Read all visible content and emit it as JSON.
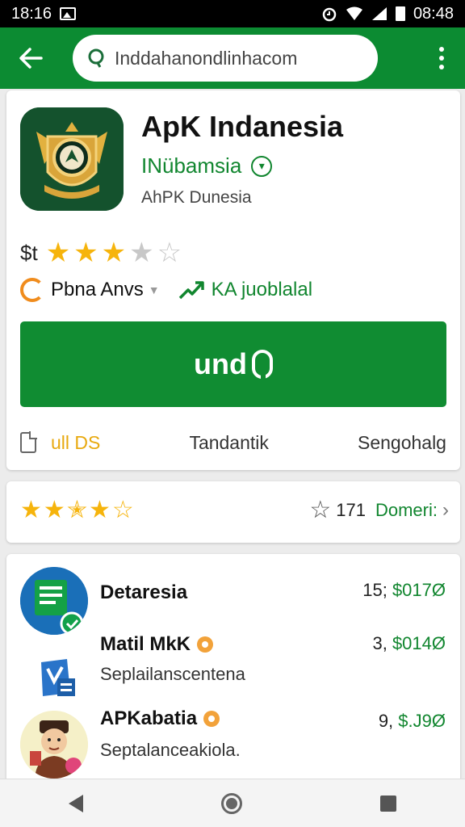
{
  "status_bar": {
    "time_left": "18:16",
    "time_right": "08:48"
  },
  "toolbar": {
    "search_text": "Inddahanondlinhacom"
  },
  "app": {
    "title": "ApK Indanesia",
    "developer": "INübamsia",
    "subtitle": "AhPK Dunesia",
    "price": "$t",
    "rating_stars": {
      "full": 3,
      "empty": 2
    },
    "tag_category": "Pbna Anvs",
    "tag_feature": "KA juoblalal",
    "install_label": "und",
    "info_size": "ull DS",
    "info_mid": "Tandantik",
    "info_right": "Sengohalg"
  },
  "ratings": {
    "star_count": 5,
    "review_count": "171",
    "review_link": "Domeri:"
  },
  "related_apps": [
    {
      "title": "Detaresia",
      "description": "",
      "count_prefix": "15;",
      "count_value": "$017Ø"
    },
    {
      "title": "Matil MkK",
      "description": "Seplailanscentena",
      "count_prefix": "3,",
      "count_value": "$014Ø"
    },
    {
      "title": "APKabatia",
      "description": "Septalanceakiola.",
      "count_prefix": "9,",
      "count_value": "$.J9Ø"
    }
  ],
  "colors": {
    "brand_green": "#0c8b32",
    "star_gold": "#f6b40c",
    "accent_orange": "#f08c1d"
  },
  "icons": {
    "back": "arrow-left-icon",
    "search": "search-icon",
    "menu": "more-vert-icon",
    "category": "category-icon",
    "feature": "trend-icon",
    "document": "document-icon"
  }
}
